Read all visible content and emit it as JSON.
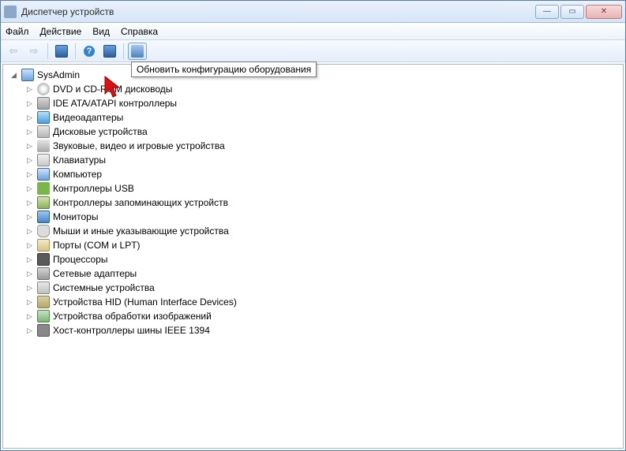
{
  "window": {
    "title": "Диспетчер устройств"
  },
  "menu": {
    "file": "Файл",
    "action": "Действие",
    "view": "Вид",
    "help": "Справка"
  },
  "tooltip": "Обновить конфигурацию оборудования",
  "tree": {
    "root": "SysAdmin",
    "items": [
      {
        "label": "DVD и CD-ROM дисководы",
        "icon": "i-disc"
      },
      {
        "label": "IDE ATA/ATAPI контроллеры",
        "icon": "i-ide"
      },
      {
        "label": "Видеоадаптеры",
        "icon": "i-video"
      },
      {
        "label": "Дисковые устройства",
        "icon": "i-disk"
      },
      {
        "label": "Звуковые, видео и игровые устройства",
        "icon": "i-sound"
      },
      {
        "label": "Клавиатуры",
        "icon": "i-keyboard"
      },
      {
        "label": "Компьютер",
        "icon": "i-pc"
      },
      {
        "label": "Контроллеры USB",
        "icon": "i-usb"
      },
      {
        "label": "Контроллеры запоминающих устройств",
        "icon": "i-storage"
      },
      {
        "label": "Мониторы",
        "icon": "i-monitor"
      },
      {
        "label": "Мыши и иные указывающие устройства",
        "icon": "i-mouse"
      },
      {
        "label": "Порты (COM и LPT)",
        "icon": "i-port"
      },
      {
        "label": "Процессоры",
        "icon": "i-cpu"
      },
      {
        "label": "Сетевые адаптеры",
        "icon": "i-net"
      },
      {
        "label": "Системные устройства",
        "icon": "i-sys"
      },
      {
        "label": "Устройства HID (Human Interface Devices)",
        "icon": "i-hid"
      },
      {
        "label": "Устройства обработки изображений",
        "icon": "i-image"
      },
      {
        "label": "Хост-контроллеры шины IEEE 1394",
        "icon": "i-1394"
      }
    ]
  }
}
